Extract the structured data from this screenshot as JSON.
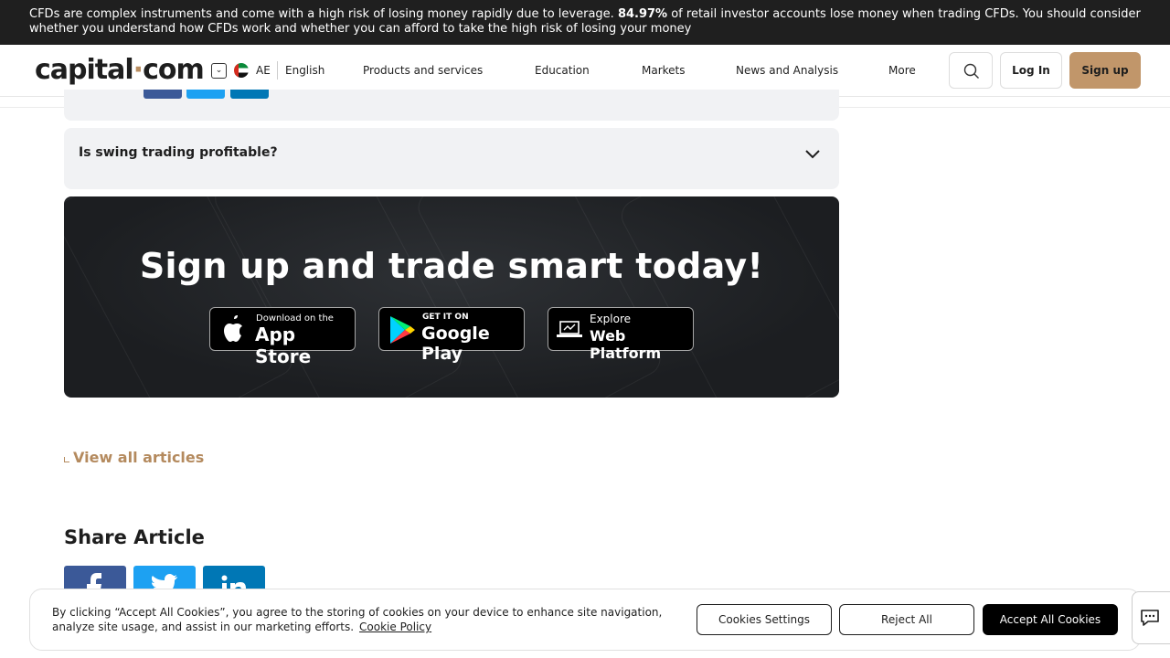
{
  "risk_warning": {
    "before": "CFDs are complex instruments and come with a high risk of losing money rapidly due to leverage. ",
    "percent": "84.97%",
    "after": " of retail investor accounts lose money when trading CFDs. You should consider whether you understand how CFDs work and whether you can afford to take the high risk of losing your money"
  },
  "header": {
    "logo_left": "capital",
    "logo_dot": "·",
    "logo_right": "com",
    "region_code": "AE",
    "language": "English",
    "nav": [
      "Products and services",
      "Education",
      "Markets",
      "News and Analysis",
      "More"
    ],
    "login_label": "Log In",
    "signup_label": "Sign up"
  },
  "faq": {
    "question": "Is swing trading profitable?"
  },
  "banner": {
    "title": "Sign up and trade smart today!",
    "app_store": {
      "small": "Download on the",
      "big": "App Store"
    },
    "google_play": {
      "small": "GET IT ON",
      "big": "Google Play"
    },
    "web_platform": {
      "small": "Explore",
      "big": "Web Platform"
    }
  },
  "view_all_label": "View all articles",
  "share": {
    "title": "Share Article",
    "facebook_color": "#3b5998",
    "twitter_color": "#1da1f2",
    "linkedin_color": "#0077b5"
  },
  "cookie": {
    "text": "By clicking “Accept All Cookies”, you agree to the storing of cookies on your device to enhance site navigation, analyze site usage, and assist in our marketing efforts.",
    "policy_link": "Cookie Policy",
    "settings_label": "Cookies Settings",
    "reject_label": "Reject All",
    "accept_label": "Accept All Cookies"
  },
  "colors": {
    "accent": "#c1966a",
    "link": "#b48a5e",
    "risk_bar_bg": "#1f1f1f"
  }
}
